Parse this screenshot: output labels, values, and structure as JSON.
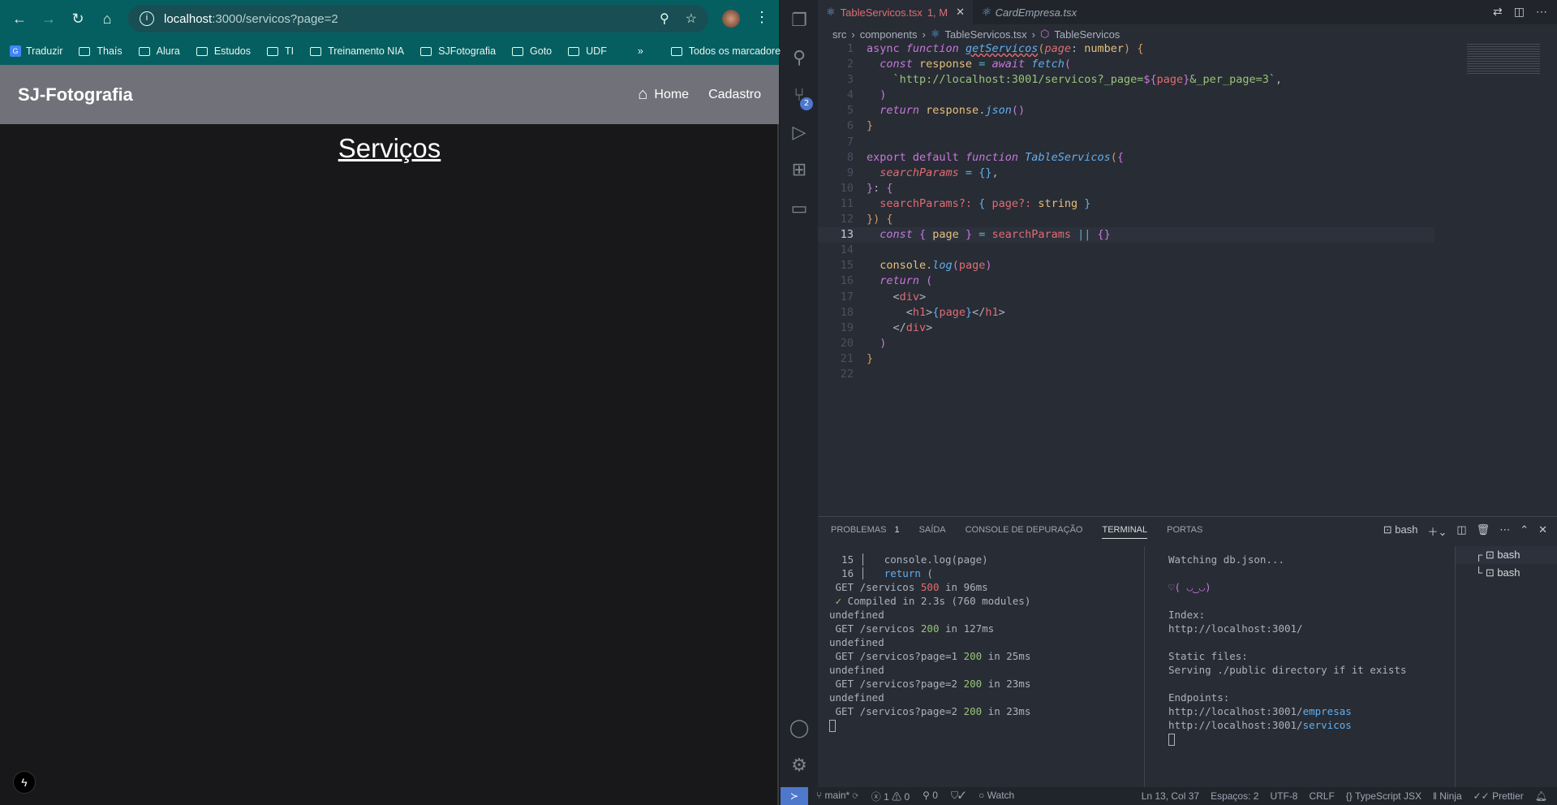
{
  "browser": {
    "url_host": "localhost",
    "url_path": ":3000/servicos?page=2",
    "bookmarks": [
      "Traduzir",
      "Thaís",
      "Alura",
      "Estudos",
      "TI",
      "Treinamento NIA",
      "SJFotografia",
      "Goto",
      "UDF"
    ],
    "more": "»",
    "all_bookmarks": "Todos os marcadores"
  },
  "app": {
    "brand": "SJ-Fotografia",
    "nav": [
      "Home",
      "Cadastro"
    ],
    "title": "Serviços"
  },
  "editor": {
    "tabs": [
      {
        "label": "TableServicos.tsx",
        "status": "1, M"
      },
      {
        "label": "CardEmpresa.tsx"
      }
    ],
    "breadcrumb": [
      "src",
      "components",
      "TableServicos.tsx",
      "TableServicos"
    ],
    "current_line": 13,
    "lines": [
      [
        [
          "async ",
          "k"
        ],
        [
          "function ",
          "ki"
        ],
        [
          "getServicos",
          "f"
        ],
        [
          "(",
          "b1"
        ],
        [
          "page",
          "p"
        ],
        [
          ": ",
          "w"
        ],
        [
          "number",
          "t"
        ],
        [
          ") ",
          "b1"
        ],
        [
          "{",
          "b1"
        ]
      ],
      [
        [
          "  const ",
          "ki"
        ],
        [
          "response ",
          "v"
        ],
        [
          "= ",
          "o"
        ],
        [
          "await ",
          "ki"
        ],
        [
          "fetch",
          "f"
        ],
        [
          "(",
          "b2"
        ]
      ],
      [
        [
          "    `http://localhost:3001/servicos?_page=",
          "s"
        ],
        [
          "${",
          "k"
        ],
        [
          "page",
          "r"
        ],
        [
          "}",
          "k"
        ],
        [
          "&_per_page=3`",
          "s"
        ],
        [
          ",",
          "w"
        ]
      ],
      [
        [
          "  )",
          "b2"
        ]
      ],
      [
        [
          "  return ",
          "ki"
        ],
        [
          "response",
          "v"
        ],
        [
          ".",
          "w"
        ],
        [
          "json",
          "f"
        ],
        [
          "()",
          "b2"
        ]
      ],
      [
        [
          "}",
          "b1"
        ]
      ],
      [],
      [
        [
          "export ",
          "k"
        ],
        [
          "default ",
          "k"
        ],
        [
          "function ",
          "ki"
        ],
        [
          "TableServicos",
          "f"
        ],
        [
          "(",
          "b1"
        ],
        [
          "{",
          "b2"
        ]
      ],
      [
        [
          "  searchParams ",
          "p"
        ],
        [
          "= ",
          "o"
        ],
        [
          "{}",
          "b3"
        ],
        [
          ",",
          "w"
        ]
      ],
      [
        [
          "}",
          "b2"
        ],
        [
          ": ",
          "w"
        ],
        [
          "{",
          "b2"
        ]
      ],
      [
        [
          "  searchParams?: ",
          "r"
        ],
        [
          "{ ",
          "b3"
        ],
        [
          "page?: ",
          "r"
        ],
        [
          "string ",
          "t"
        ],
        [
          "}",
          "b3"
        ]
      ],
      [
        [
          "})",
          "b1"
        ],
        [
          " {",
          "b1"
        ]
      ],
      [
        [
          "  const ",
          "ki"
        ],
        [
          "{ ",
          "b2"
        ],
        [
          "page ",
          "v"
        ],
        [
          "} ",
          "b2"
        ],
        [
          "= ",
          "o"
        ],
        [
          "searchParams ",
          "r"
        ],
        [
          "|| ",
          "o"
        ],
        [
          "{}",
          "b2"
        ]
      ],
      [],
      [
        [
          "  console",
          "v"
        ],
        [
          ".",
          "w"
        ],
        [
          "log",
          "f"
        ],
        [
          "(",
          "b2"
        ],
        [
          "page",
          "r"
        ],
        [
          ")",
          "b2"
        ]
      ],
      [
        [
          "  return ",
          "ki"
        ],
        [
          "(",
          "b2"
        ]
      ],
      [
        [
          "    <",
          "w"
        ],
        [
          "div",
          "tg"
        ],
        [
          ">",
          "w"
        ]
      ],
      [
        [
          "      <",
          "w"
        ],
        [
          "h1",
          "tg"
        ],
        [
          ">",
          "w"
        ],
        [
          "{",
          "b3"
        ],
        [
          "page",
          "r"
        ],
        [
          "}",
          "b3"
        ],
        [
          "</",
          "w"
        ],
        [
          "h1",
          "tg"
        ],
        [
          ">",
          "w"
        ]
      ],
      [
        [
          "    </",
          "w"
        ],
        [
          "div",
          "tg"
        ],
        [
          ">",
          "w"
        ]
      ],
      [
        [
          "  )",
          "b2"
        ]
      ],
      [
        [
          "}",
          "b1"
        ]
      ],
      []
    ]
  },
  "panel": {
    "tabs": [
      "PROBLEMAS",
      "SAÍDA",
      "CONSOLE DE DEPURAÇÃO",
      "TERMINAL",
      "PORTAS"
    ],
    "problems_count": "1",
    "active_tab": "TERMINAL",
    "shell": "bash",
    "terminal_left": [
      [
        [
          "  15 │   console.log(page)",
          "w"
        ]
      ],
      [
        [
          "  16 │   ",
          "w"
        ],
        [
          "return",
          "fn"
        ],
        [
          " (",
          "w"
        ]
      ],
      [
        [
          " GET /servicos ",
          "w"
        ],
        [
          "500",
          "r"
        ],
        [
          " in 96ms",
          "w"
        ]
      ],
      [
        [
          " ✓",
          "s"
        ],
        [
          " Compiled in 2.3s (760 modules)",
          "w"
        ]
      ],
      [
        [
          "undefined",
          "w"
        ]
      ],
      [
        [
          " GET /servicos ",
          "w"
        ],
        [
          "200",
          "s"
        ],
        [
          " in 127ms",
          "w"
        ]
      ],
      [
        [
          "undefined",
          "w"
        ]
      ],
      [
        [
          " GET /servicos?page=1 ",
          "w"
        ],
        [
          "200",
          "s"
        ],
        [
          " in 25ms",
          "w"
        ]
      ],
      [
        [
          "undefined",
          "w"
        ]
      ],
      [
        [
          " GET /servicos?page=2 ",
          "w"
        ],
        [
          "200",
          "s"
        ],
        [
          " in 23ms",
          "w"
        ]
      ],
      [
        [
          "undefined",
          "w"
        ]
      ],
      [
        [
          " GET /servicos?page=2 ",
          "w"
        ],
        [
          "200",
          "s"
        ],
        [
          " in 23ms",
          "w"
        ]
      ]
    ],
    "terminal_right": [
      [
        [
          "Watching db.json...",
          "w"
        ]
      ],
      [
        [
          "",
          ""
        ]
      ],
      [
        [
          "♡( ◡‿◡)",
          "b2"
        ]
      ],
      [
        [
          "",
          ""
        ]
      ],
      [
        [
          "Index:",
          "w"
        ]
      ],
      [
        [
          "http://localhost:3001/",
          "w"
        ]
      ],
      [
        [
          "",
          ""
        ]
      ],
      [
        [
          "Static files:",
          "w"
        ]
      ],
      [
        [
          "Serving ./public directory if it exists",
          "w"
        ]
      ],
      [
        [
          "",
          ""
        ]
      ],
      [
        [
          "Endpoints:",
          "w"
        ]
      ],
      [
        [
          "http://localhost:3001/",
          "w"
        ],
        [
          "empresas",
          "fn"
        ]
      ],
      [
        [
          "http://localhost:3001/",
          "w"
        ],
        [
          "servicos",
          "fn"
        ]
      ]
    ],
    "terminals": [
      "bash",
      "bash"
    ]
  },
  "status": {
    "branch": "main*",
    "errors": "1",
    "warnings": "0",
    "ports": "0",
    "watch": "Watch",
    "position": "Ln 13, Col 37",
    "spaces": "Espaços: 2",
    "encoding": "UTF-8",
    "eol": "CRLF",
    "language": "TypeScript JSX",
    "ninja": "Ninja",
    "prettier": "Prettier"
  }
}
